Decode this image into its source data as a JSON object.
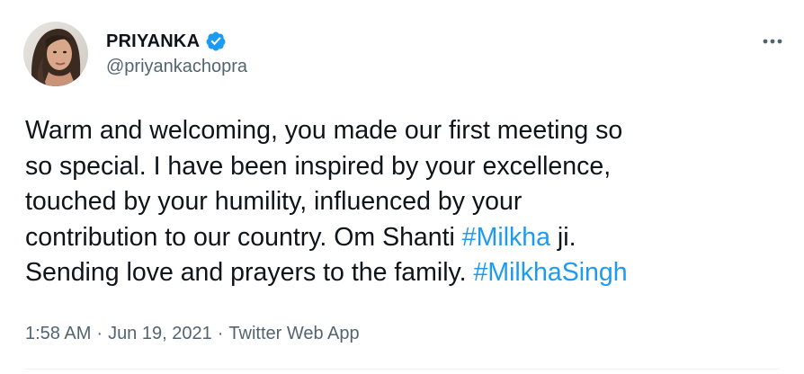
{
  "author": {
    "display_name": "PRIYANKA",
    "handle": "@priyankachopra",
    "verified": true,
    "avatar_icon": "profile-photo"
  },
  "tweet": {
    "lines": [
      {
        "parts": [
          {
            "text": "Warm and welcoming, you made our first meeting so",
            "hashtag": false
          }
        ]
      },
      {
        "parts": [
          {
            "text": "so special. I have been inspired by your excellence,",
            "hashtag": false
          }
        ]
      },
      {
        "parts": [
          {
            "text": "touched by your humility, influenced by your",
            "hashtag": false
          }
        ]
      },
      {
        "parts": [
          {
            "text": "contribution to our country. Om Shanti ",
            "hashtag": false
          },
          {
            "text": "#Milkha",
            "hashtag": true
          },
          {
            "text": " ji.",
            "hashtag": false
          }
        ]
      },
      {
        "parts": [
          {
            "text": "Sending love and prayers to the family. ",
            "hashtag": false
          },
          {
            "text": "#MilkhaSingh",
            "hashtag": true
          }
        ]
      }
    ]
  },
  "meta": {
    "time": "1:58 AM",
    "separator": "·",
    "date": "Jun 19, 2021",
    "source": "Twitter Web App"
  },
  "colors": {
    "text": "#0f1419",
    "secondary": "#536471",
    "link": "#1d9bf0",
    "verified": "#1d9bf0"
  },
  "icons": {
    "more": "more-horizontal-icon",
    "verified": "verified-badge-icon"
  }
}
